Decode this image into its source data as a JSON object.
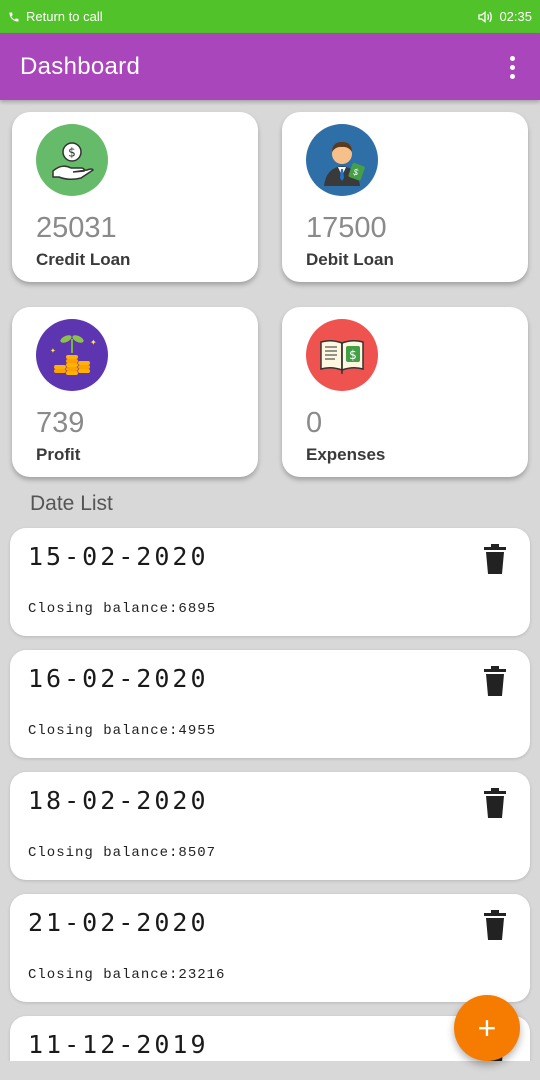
{
  "status_bar": {
    "call_text": "Return to call",
    "time": "02:35",
    "icons": [
      "phone-icon",
      "speaker-icon"
    ]
  },
  "app_bar": {
    "title": "Dashboard",
    "menu_icon": "more-vert-icon"
  },
  "cards": [
    {
      "value": "25031",
      "label": "Credit Loan",
      "icon": "money-hand-icon",
      "color": "#66bb6a"
    },
    {
      "value": "17500",
      "label": "Debit Loan",
      "icon": "businessman-icon",
      "color": "#2f6fa8"
    },
    {
      "value": "739",
      "label": "Profit",
      "icon": "coins-plant-icon",
      "color": "#5e35b1"
    },
    {
      "value": "0",
      "label": "Expenses",
      "icon": "ledger-book-icon",
      "color": "#ef5350"
    }
  ],
  "section_title": "Date List",
  "date_list": [
    {
      "date": "15-02-2020",
      "balance": "Closing balance:6895"
    },
    {
      "date": "16-02-2020",
      "balance": "Closing balance:4955"
    },
    {
      "date": "18-02-2020",
      "balance": "Closing balance:8507"
    },
    {
      "date": "21-02-2020",
      "balance": "Closing balance:23216"
    },
    {
      "date": "11-12-2019",
      "balance": ""
    }
  ],
  "fab": {
    "label": "+",
    "icon": "add-icon",
    "color": "#f57c00"
  },
  "colors": {
    "status_bar": "#52c22a",
    "app_bar": "#a946bb",
    "background": "#d8d8d8"
  }
}
